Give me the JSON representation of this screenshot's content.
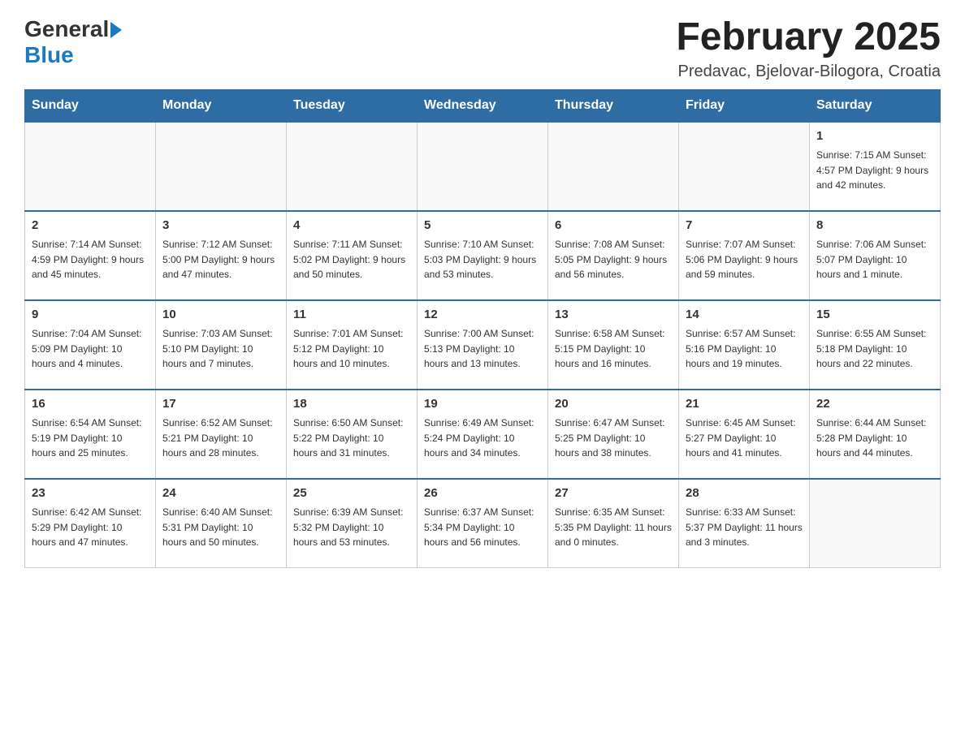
{
  "logo": {
    "general": "General",
    "blue": "Blue"
  },
  "title": "February 2025",
  "location": "Predavac, Bjelovar-Bilogora, Croatia",
  "days_header": [
    "Sunday",
    "Monday",
    "Tuesday",
    "Wednesday",
    "Thursday",
    "Friday",
    "Saturday"
  ],
  "weeks": [
    [
      {
        "day": "",
        "info": ""
      },
      {
        "day": "",
        "info": ""
      },
      {
        "day": "",
        "info": ""
      },
      {
        "day": "",
        "info": ""
      },
      {
        "day": "",
        "info": ""
      },
      {
        "day": "",
        "info": ""
      },
      {
        "day": "1",
        "info": "Sunrise: 7:15 AM\nSunset: 4:57 PM\nDaylight: 9 hours and 42 minutes."
      }
    ],
    [
      {
        "day": "2",
        "info": "Sunrise: 7:14 AM\nSunset: 4:59 PM\nDaylight: 9 hours and 45 minutes."
      },
      {
        "day": "3",
        "info": "Sunrise: 7:12 AM\nSunset: 5:00 PM\nDaylight: 9 hours and 47 minutes."
      },
      {
        "day": "4",
        "info": "Sunrise: 7:11 AM\nSunset: 5:02 PM\nDaylight: 9 hours and 50 minutes."
      },
      {
        "day": "5",
        "info": "Sunrise: 7:10 AM\nSunset: 5:03 PM\nDaylight: 9 hours and 53 minutes."
      },
      {
        "day": "6",
        "info": "Sunrise: 7:08 AM\nSunset: 5:05 PM\nDaylight: 9 hours and 56 minutes."
      },
      {
        "day": "7",
        "info": "Sunrise: 7:07 AM\nSunset: 5:06 PM\nDaylight: 9 hours and 59 minutes."
      },
      {
        "day": "8",
        "info": "Sunrise: 7:06 AM\nSunset: 5:07 PM\nDaylight: 10 hours and 1 minute."
      }
    ],
    [
      {
        "day": "9",
        "info": "Sunrise: 7:04 AM\nSunset: 5:09 PM\nDaylight: 10 hours and 4 minutes."
      },
      {
        "day": "10",
        "info": "Sunrise: 7:03 AM\nSunset: 5:10 PM\nDaylight: 10 hours and 7 minutes."
      },
      {
        "day": "11",
        "info": "Sunrise: 7:01 AM\nSunset: 5:12 PM\nDaylight: 10 hours and 10 minutes."
      },
      {
        "day": "12",
        "info": "Sunrise: 7:00 AM\nSunset: 5:13 PM\nDaylight: 10 hours and 13 minutes."
      },
      {
        "day": "13",
        "info": "Sunrise: 6:58 AM\nSunset: 5:15 PM\nDaylight: 10 hours and 16 minutes."
      },
      {
        "day": "14",
        "info": "Sunrise: 6:57 AM\nSunset: 5:16 PM\nDaylight: 10 hours and 19 minutes."
      },
      {
        "day": "15",
        "info": "Sunrise: 6:55 AM\nSunset: 5:18 PM\nDaylight: 10 hours and 22 minutes."
      }
    ],
    [
      {
        "day": "16",
        "info": "Sunrise: 6:54 AM\nSunset: 5:19 PM\nDaylight: 10 hours and 25 minutes."
      },
      {
        "day": "17",
        "info": "Sunrise: 6:52 AM\nSunset: 5:21 PM\nDaylight: 10 hours and 28 minutes."
      },
      {
        "day": "18",
        "info": "Sunrise: 6:50 AM\nSunset: 5:22 PM\nDaylight: 10 hours and 31 minutes."
      },
      {
        "day": "19",
        "info": "Sunrise: 6:49 AM\nSunset: 5:24 PM\nDaylight: 10 hours and 34 minutes."
      },
      {
        "day": "20",
        "info": "Sunrise: 6:47 AM\nSunset: 5:25 PM\nDaylight: 10 hours and 38 minutes."
      },
      {
        "day": "21",
        "info": "Sunrise: 6:45 AM\nSunset: 5:27 PM\nDaylight: 10 hours and 41 minutes."
      },
      {
        "day": "22",
        "info": "Sunrise: 6:44 AM\nSunset: 5:28 PM\nDaylight: 10 hours and 44 minutes."
      }
    ],
    [
      {
        "day": "23",
        "info": "Sunrise: 6:42 AM\nSunset: 5:29 PM\nDaylight: 10 hours and 47 minutes."
      },
      {
        "day": "24",
        "info": "Sunrise: 6:40 AM\nSunset: 5:31 PM\nDaylight: 10 hours and 50 minutes."
      },
      {
        "day": "25",
        "info": "Sunrise: 6:39 AM\nSunset: 5:32 PM\nDaylight: 10 hours and 53 minutes."
      },
      {
        "day": "26",
        "info": "Sunrise: 6:37 AM\nSunset: 5:34 PM\nDaylight: 10 hours and 56 minutes."
      },
      {
        "day": "27",
        "info": "Sunrise: 6:35 AM\nSunset: 5:35 PM\nDaylight: 11 hours and 0 minutes."
      },
      {
        "day": "28",
        "info": "Sunrise: 6:33 AM\nSunset: 5:37 PM\nDaylight: 11 hours and 3 minutes."
      },
      {
        "day": "",
        "info": ""
      }
    ]
  ]
}
